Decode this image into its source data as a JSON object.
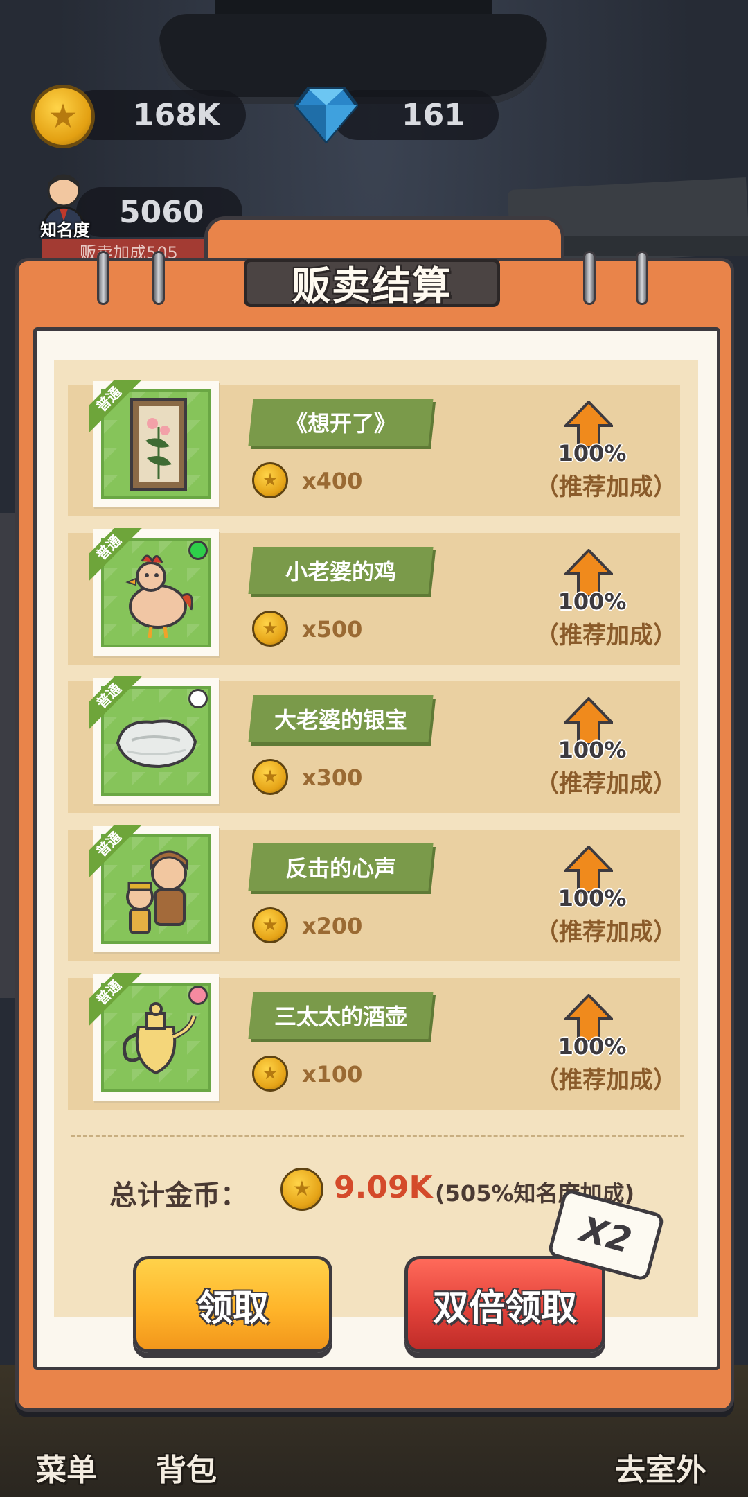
{
  "hud": {
    "coins": "168K",
    "gems": "161",
    "fame_value": "5060",
    "fame_label": "知名度",
    "buff_text": "贩卖加成505"
  },
  "panel": {
    "title": "贩卖结算"
  },
  "items": [
    {
      "badge": "普通",
      "name": "《想开了》",
      "price": "x400",
      "bonus_pct": "100%",
      "bonus_label": "（推荐加成）",
      "dot_color": ""
    },
    {
      "badge": "普通",
      "name": "小老婆的鸡",
      "price": "x500",
      "bonus_pct": "100%",
      "bonus_label": "（推荐加成）",
      "dot_color": "#2ecf4a"
    },
    {
      "badge": "普通",
      "name": "大老婆的银宝",
      "price": "x300",
      "bonus_pct": "100%",
      "bonus_label": "（推荐加成）",
      "dot_color": "#ffffff"
    },
    {
      "badge": "普通",
      "name": "反击的心声",
      "price": "x200",
      "bonus_pct": "100%",
      "bonus_label": "（推荐加成）",
      "dot_color": ""
    },
    {
      "badge": "普通",
      "name": "三太太的酒壶",
      "price": "x100",
      "bonus_pct": "100%",
      "bonus_label": "（推荐加成）",
      "dot_color": "#f58aa0"
    }
  ],
  "summary": {
    "label": "总计金币：",
    "value": "9.09K",
    "bonus": "(505%知名度加成)"
  },
  "buttons": {
    "claim": "领取",
    "double_claim": "双倍领取",
    "x2_tag": "X2"
  },
  "bottom_nav": {
    "menu": "菜单",
    "backpack": "背包",
    "outdoor": "去室外"
  },
  "colors": {
    "accent_orange": "#e9844a",
    "item_green": "#7a9a4a",
    "total_red": "#d44a2a"
  }
}
